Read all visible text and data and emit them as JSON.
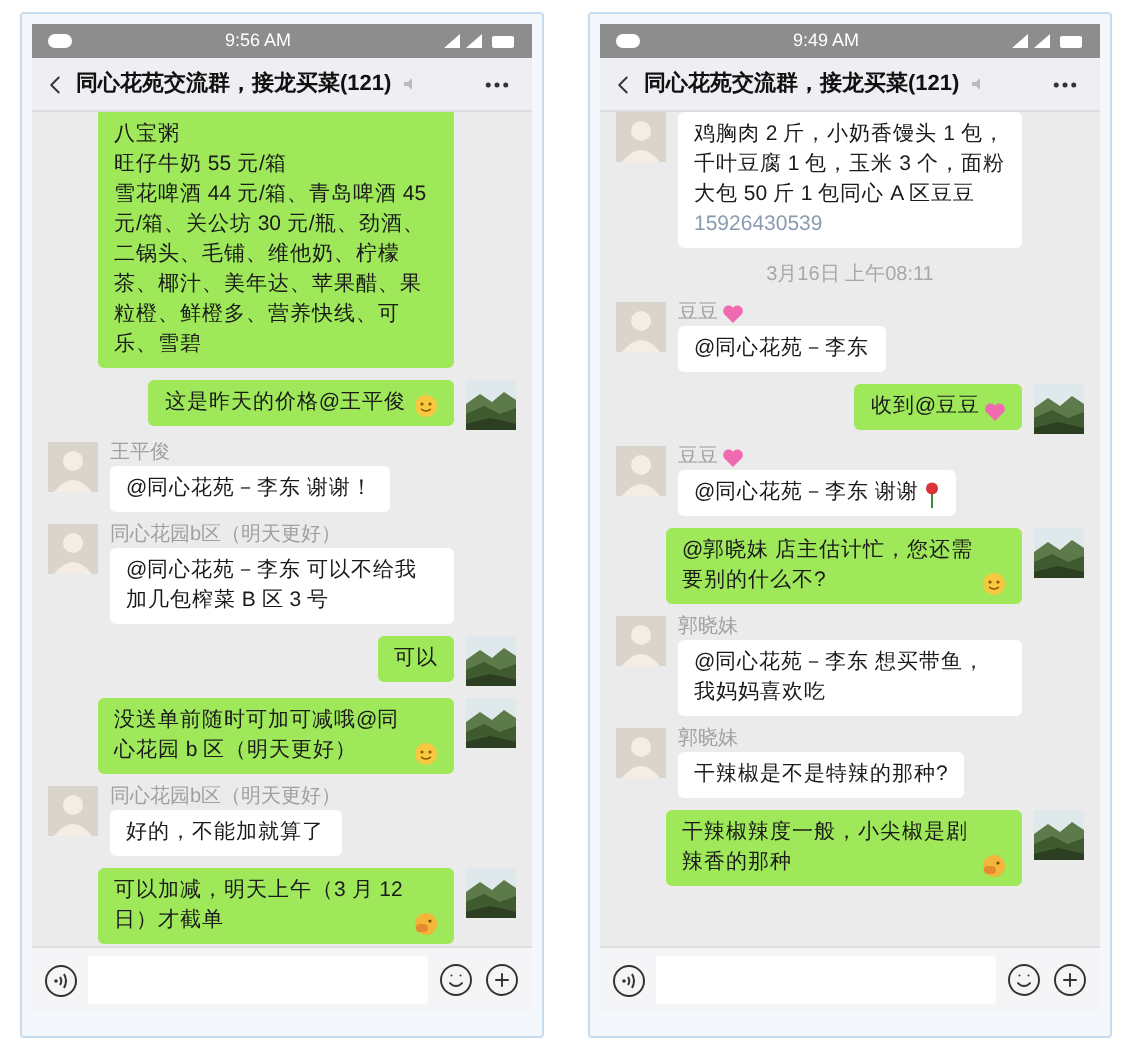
{
  "phones": [
    {
      "status_bar": {
        "time": "9:56 AM"
      },
      "header": {
        "title": "同心花苑交流群，接龙买菜(121)"
      },
      "messages": [
        {
          "kind": "out",
          "continued": true,
          "lines": [
            "八宝粥",
            "旺仔牛奶 55 元/箱",
            "雪花啤酒 44 元/箱、青岛啤酒 45 元/箱、关公坊 30 元/瓶、劲酒、二锅头、毛铺、维他奶、柠檬茶、椰汁、美年达、苹果醋、果粒橙、鲜橙多、营养快线、可乐、雪碧"
          ]
        },
        {
          "kind": "out",
          "lines": [
            "这是昨天的价格@王平俊"
          ],
          "emoji": {
            "kind": "smile"
          }
        },
        {
          "kind": "in",
          "sender": "王平俊",
          "lines": [
            "@同心花苑－李东  谢谢！"
          ]
        },
        {
          "kind": "in",
          "sender": "同心花园b区（明天更好）",
          "lines": [
            "@同心花苑－李东  可以不给我加几包榨菜 B 区 3 号"
          ]
        },
        {
          "kind": "out",
          "lines": [
            "可以"
          ]
        },
        {
          "kind": "out",
          "lines": [
            "没送单前随时可加可减哦@同心花园 b 区（明天更好）"
          ],
          "emoji": {
            "kind": "smile"
          }
        },
        {
          "kind": "in",
          "sender": "同心花园b区（明天更好）",
          "lines": [
            "好的，不能加就算了"
          ]
        },
        {
          "kind": "out",
          "lines": [
            "可以加减，明天上午（3 月 12 日）才截单"
          ],
          "emoji": {
            "kind": "wry"
          }
        }
      ]
    },
    {
      "status_bar": {
        "time": "9:49 AM"
      },
      "header": {
        "title": "同心花苑交流群，接龙买菜(121)"
      },
      "messages": [
        {
          "kind": "in",
          "lines": [
            "鸡胸肉 2 斤，小奶香馒头 1 包，千叶豆腐 1 包，玉米 3 个，面粉大包 50 斤 1 包同心 A 区豆豆"
          ],
          "link": "15926430539"
        },
        {
          "kind": "time",
          "text": "3月16日 上午08:11"
        },
        {
          "kind": "in",
          "sender": "豆豆",
          "sender_emoji": {
            "kind": "heart"
          },
          "lines": [
            "@同心花苑－李东"
          ]
        },
        {
          "kind": "out",
          "lines": [
            "收到@豆豆"
          ],
          "emoji": {
            "kind": "heart"
          }
        },
        {
          "kind": "in",
          "sender": "豆豆",
          "sender_emoji": {
            "kind": "heart"
          },
          "lines": [
            "@同心花苑－李东  谢谢"
          ],
          "emoji": {
            "kind": "rose"
          }
        },
        {
          "kind": "out",
          "lines": [
            "@郭晓妹  店主估计忙，您还需要别的什么不?"
          ],
          "emoji": {
            "kind": "smile"
          }
        },
        {
          "kind": "in",
          "sender": "郭晓妹",
          "lines": [
            "@同心花苑－李东  想买带鱼，我妈妈喜欢吃"
          ]
        },
        {
          "kind": "in",
          "sender": "郭晓妹",
          "lines": [
            "干辣椒是不是特辣的那种?"
          ]
        },
        {
          "kind": "out",
          "lines": [
            "干辣椒辣度一般，小尖椒是剧辣香的那种"
          ],
          "emoji": {
            "kind": "wry"
          }
        }
      ]
    }
  ]
}
